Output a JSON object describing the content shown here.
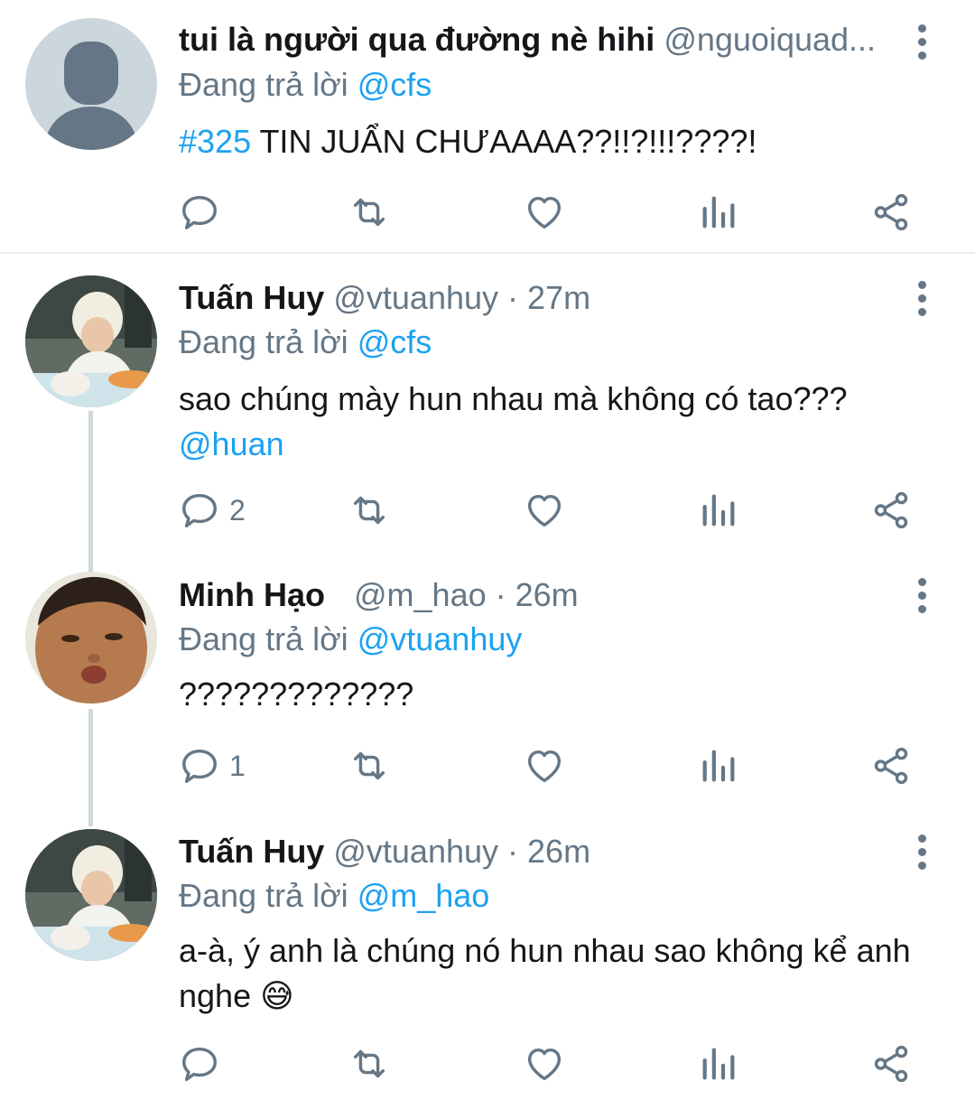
{
  "tweets": [
    {
      "name": "tui là người qua đường nè hihi",
      "handle": "@nguoiquad...",
      "time": "",
      "reply_prefix": "Đang trả lời",
      "reply_to": "@cfs",
      "text_link": "#325",
      "text": " TIN JUẨN CHƯAAAA??!!?!!!????!",
      "reply_count": "",
      "avatar": "default-avatar"
    },
    {
      "name": "Tuấn Huy",
      "handle": "@vtuanhuy",
      "time": "· 27m",
      "reply_prefix": "Đang trả lời",
      "reply_to": "@cfs",
      "text": "sao chúng mày hun nhau mà không có tao???",
      "text_link": "@huan",
      "reply_count": "2",
      "avatar": "blonde-person-eating-photo"
    },
    {
      "name": "Minh Hạo",
      "handle": "@m_hao",
      "time": "· 26m",
      "reply_prefix": "Đang trả lời",
      "reply_to": "@vtuanhuy",
      "text": "?????????????",
      "reply_count": "1",
      "avatar": "child-pouting-face-photo"
    },
    {
      "name": "Tuấn Huy",
      "handle": "@vtuanhuy",
      "time": "· 26m",
      "reply_prefix": "Đang trả lời",
      "reply_to": "@m_hao",
      "text": "a-à, ý anh là chúng nó hun nhau sao không kể anh nghe",
      "emoji": "😅",
      "reply_count": "",
      "avatar": "blonde-person-eating-photo"
    }
  ],
  "icons": {
    "reply": "reply-icon",
    "retweet": "retweet-icon",
    "like": "like-icon",
    "analytics": "analytics-icon",
    "share": "share-icon",
    "more": "more-options-icon"
  },
  "colors": {
    "link": "#1da1f2",
    "secondary_text": "#657786",
    "thread_line": "#cfd9de"
  }
}
